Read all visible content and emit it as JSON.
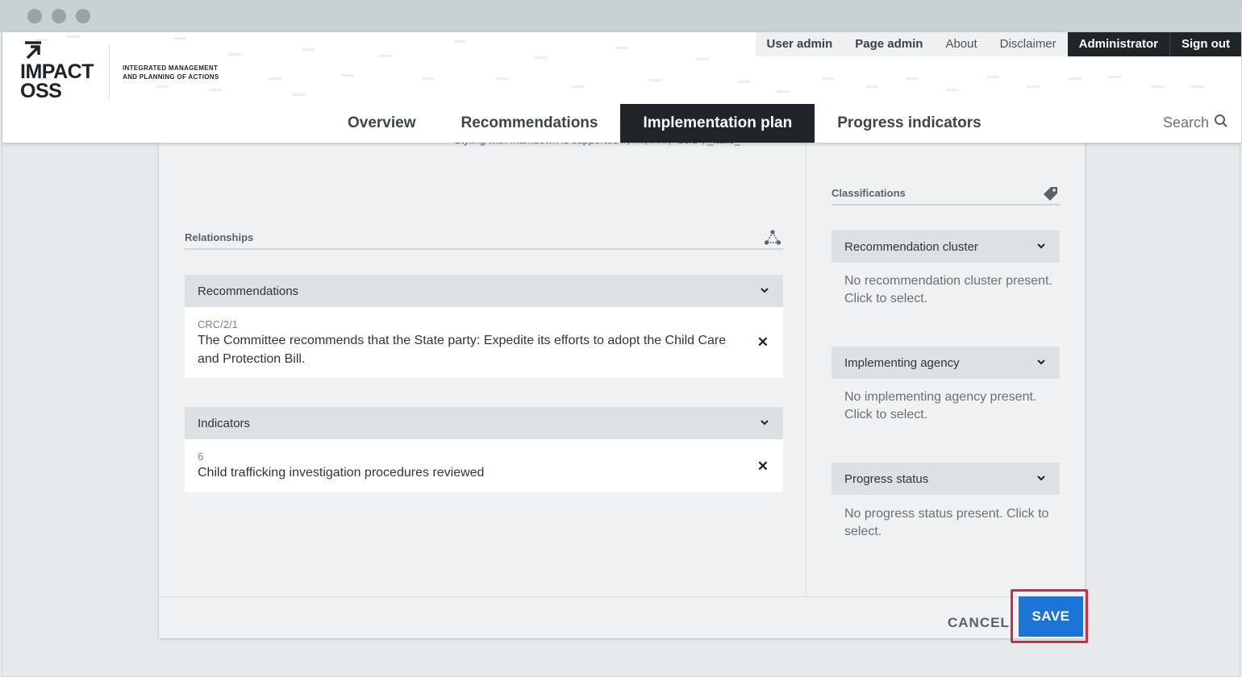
{
  "header": {
    "logo_line1": "IMPACT",
    "logo_line2": "OSS",
    "tagline_line1": "Integrated management",
    "tagline_line2": "and planning of actions"
  },
  "topnav": {
    "user_admin": "User admin",
    "page_admin": "Page admin",
    "about": "About",
    "disclaimer": "Disclaimer",
    "administrator": "Administrator",
    "sign_out": "Sign out"
  },
  "mainnav": {
    "tabs": [
      {
        "label": "Overview",
        "active": false
      },
      {
        "label": "Recommendations",
        "active": false
      },
      {
        "label": "Implementation plan",
        "active": true
      },
      {
        "label": "Progress indicators",
        "active": false
      }
    ],
    "search_label": "Search"
  },
  "content": {
    "markdown_link": "Styling with Markdown is supported",
    "markdown_hint": "#, ##, ###, *bold*, _italic_",
    "relationships": {
      "title": "Relationships",
      "recommendations": {
        "label": "Recommendations",
        "items": [
          {
            "ref": "CRC/2/1",
            "text": "The Committee recommends that the State party: Expedite its efforts to adopt the Child Care and Protection Bill."
          }
        ]
      },
      "indicators": {
        "label": "Indicators",
        "items": [
          {
            "ref": "6",
            "text": "Child trafficking investigation procedures reviewed"
          }
        ]
      }
    },
    "classifications": {
      "title": "Classifications",
      "groups": [
        {
          "label": "Recommendation cluster",
          "empty": "No recommendation cluster present. Click to select."
        },
        {
          "label": "Implementing agency",
          "empty": "No implementing agency present. Click to select."
        },
        {
          "label": "Progress status",
          "empty": "No progress status present. Click to select."
        }
      ]
    }
  },
  "actions": {
    "cancel": "CANCEL",
    "save": "SAVE"
  },
  "colors": {
    "accent": "#1c74d6",
    "dark_nav": "#202528",
    "highlight": "#c8304a"
  }
}
